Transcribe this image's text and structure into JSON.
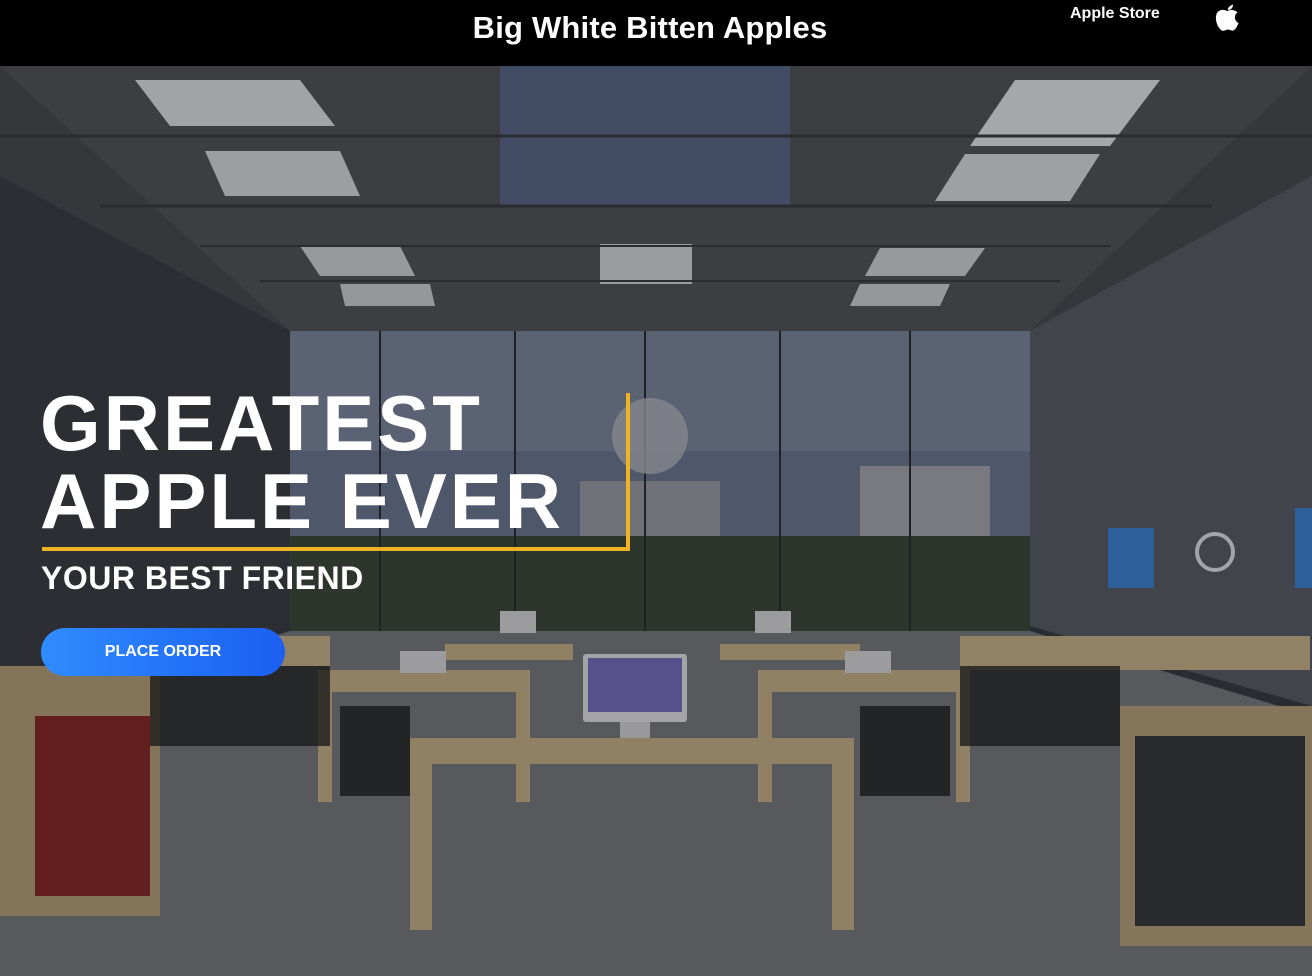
{
  "header": {
    "title": "Big White Bitten Apples",
    "store_link": "Apple Store",
    "logo_icon": "apple-icon"
  },
  "hero": {
    "headline_line1": "GREATEST",
    "headline_line2": "APPLE EVER",
    "subheadline": "YOUR BEST FRIEND",
    "cta_label": "PLACE ORDER",
    "accent_color": "#f0b323",
    "button_color": "#2a7cff",
    "background": "apple-store-interior-photo"
  }
}
